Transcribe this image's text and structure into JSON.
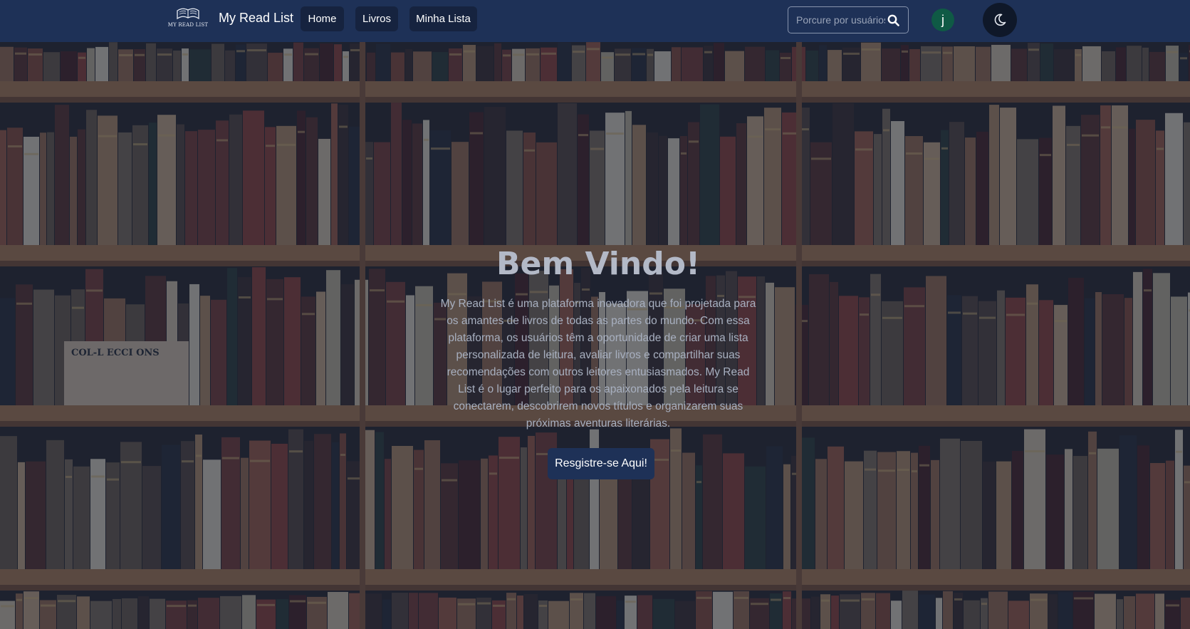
{
  "navbar": {
    "logo_text": "MY READ LIST",
    "brand": "My Read List",
    "links": [
      {
        "label": "Home"
      },
      {
        "label": "Livros"
      },
      {
        "label": "Minha Lista"
      }
    ],
    "search": {
      "placeholder": "Porcure por usuários",
      "icon": "search-icon"
    },
    "avatar_initial": "j",
    "theme_icon": "moon-icon"
  },
  "hero": {
    "title": "Bem Vindo!",
    "description": "My Read List é uma plataforma inovadora que foi projetada para os amantes de livros de todas as partes do mundo. Com essa plataforma, os usuários têm a oportunidade de criar uma lista personalizada de leitura, avaliar livros e compartilhar suas recomendações com outros leitores entusiasmados. My Read List é o lugar perfeito para os apaixonados pela leitura se conectarem, descobrirem novos títulos e organizarem suas próximas aventuras literárias.",
    "cta_label": "Resgistre-se Aqui!",
    "background_label": "COL-L ECCI ONS"
  },
  "colors": {
    "navbar_bg": "#1e3157",
    "nav_button_bg": "#16233f",
    "avatar_bg": "#0f5a45",
    "cta_bg": "#1e3157",
    "overlay": "#14203c"
  }
}
